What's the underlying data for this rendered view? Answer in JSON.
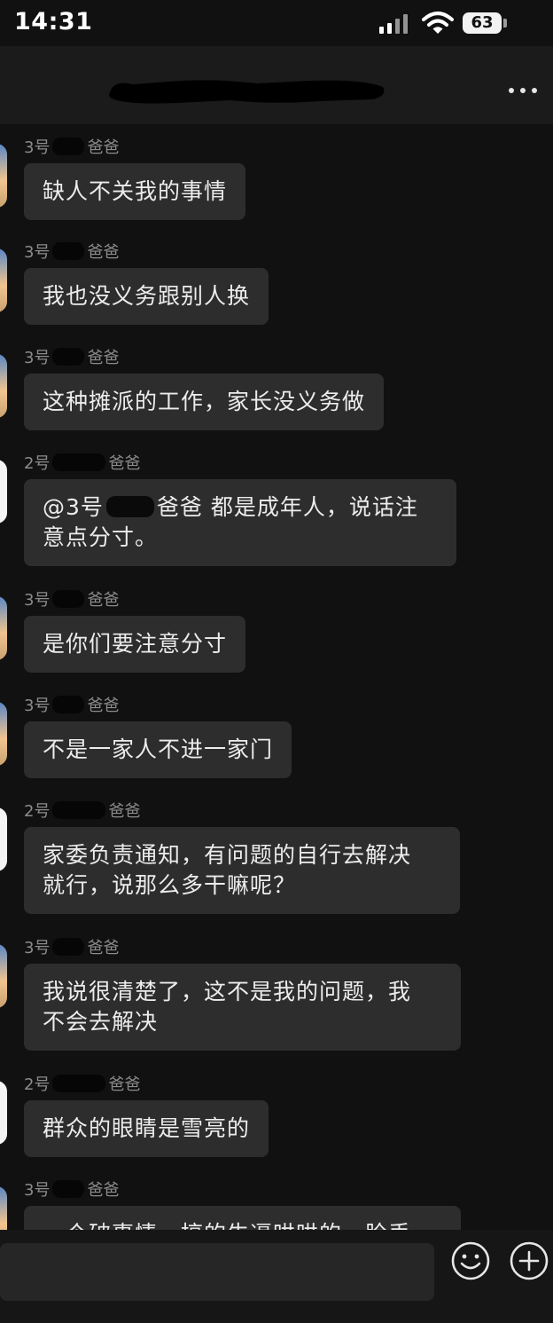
{
  "status_bar": {
    "time": "14:31",
    "battery": "63"
  },
  "header": {
    "title": "",
    "more_icon": "more-dots-icon"
  },
  "messages": [
    {
      "sender_prefix": "3号",
      "sender_suffix": "爸爸",
      "text": "缺人不关我的事情",
      "avatar": "sky"
    },
    {
      "sender_prefix": "3号",
      "sender_suffix": "爸爸",
      "text": "我也没义务跟别人换",
      "avatar": "sky"
    },
    {
      "sender_prefix": "3号",
      "sender_suffix": "爸爸",
      "text": "这种摊派的工作，家长没义务做",
      "avatar": "sky"
    },
    {
      "sender_prefix": "2号",
      "sender_suffix": "爸爸",
      "mention_prefix": "@3号",
      "mention_suffix": "爸爸",
      "text_line1": "都是成年人，说话注",
      "text_line2": "意点分寸。",
      "avatar": "white"
    },
    {
      "sender_prefix": "3号",
      "sender_suffix": "爸爸",
      "text": "是你们要注意分寸",
      "avatar": "sky"
    },
    {
      "sender_prefix": "3号",
      "sender_suffix": "爸爸",
      "text": "不是一家人不进一家门",
      "avatar": "sky"
    },
    {
      "sender_prefix": "2号",
      "sender_suffix": "爸爸",
      "text_line1": "家委负责通知，有问题的自行去解决",
      "text_line2": "就行，说那么多干嘛呢？",
      "avatar": "white"
    },
    {
      "sender_prefix": "3号",
      "sender_suffix": "爸爸",
      "text_line1": "我说很清楚了，这不是我的问题，我",
      "text_line2": "不会去解决",
      "avatar": "sky"
    },
    {
      "sender_prefix": "2号",
      "sender_suffix": "爸爸",
      "text": "群众的眼睛是雪亮的",
      "avatar": "white"
    },
    {
      "sender_prefix": "3号",
      "sender_suffix": "爸爸",
      "text": "一个破事情，搞的牛逼哄哄的，脸丢",
      "avatar": "sky"
    }
  ],
  "input_bar": {
    "value": "",
    "emoji_icon": "emoji-icon",
    "plus_icon": "plus-icon"
  }
}
